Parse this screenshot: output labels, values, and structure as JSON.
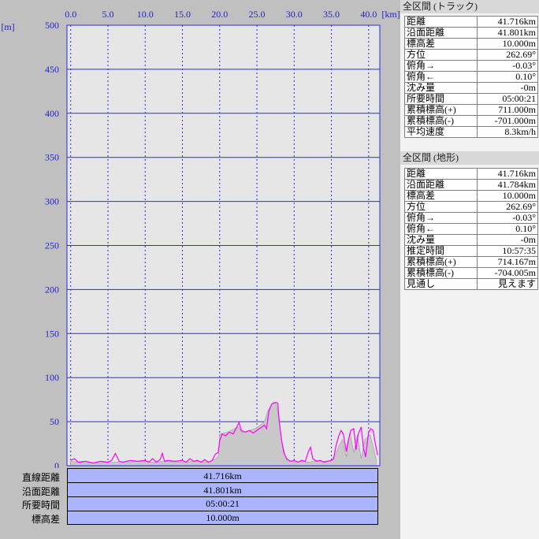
{
  "chart_data": {
    "type": "area",
    "xlabel": "[km]",
    "ylabel": "[m]",
    "xlim": [
      -0.5,
      41.5
    ],
    "ylim": [
      0,
      500
    ],
    "x_ticks": [
      "0.0",
      "5.0",
      "10.0",
      "15.0",
      "20.0",
      "25.0",
      "30.0",
      "35.0",
      "40.0"
    ],
    "y_ticks": [
      "0",
      "50",
      "100",
      "150",
      "200",
      "250",
      "300",
      "350",
      "400",
      "450",
      "500"
    ],
    "grid": true,
    "series": [
      {
        "name": "",
        "role": "terrain",
        "points": [
          [
            0,
            5
          ],
          [
            1,
            4
          ],
          [
            3,
            3
          ],
          [
            5,
            4
          ],
          [
            7,
            4
          ],
          [
            9,
            5
          ],
          [
            11,
            4
          ],
          [
            13,
            5
          ],
          [
            15,
            4
          ],
          [
            17,
            5
          ],
          [
            18.5,
            4
          ],
          [
            19.5,
            8
          ],
          [
            19.8,
            10
          ],
          [
            20,
            36
          ],
          [
            21,
            38
          ],
          [
            22,
            42
          ],
          [
            22.5,
            44
          ],
          [
            23,
            38
          ],
          [
            24,
            40
          ],
          [
            25,
            43
          ],
          [
            26,
            50
          ],
          [
            26.5,
            63
          ],
          [
            27.2,
            72
          ],
          [
            27.6,
            70
          ],
          [
            28,
            50
          ],
          [
            28.4,
            25
          ],
          [
            29,
            6
          ],
          [
            30,
            4
          ],
          [
            31,
            5
          ],
          [
            32,
            4
          ],
          [
            33,
            6
          ],
          [
            34,
            5
          ],
          [
            35,
            6
          ],
          [
            35.5,
            12
          ],
          [
            36,
            22
          ],
          [
            36.5,
            30
          ],
          [
            37,
            10
          ],
          [
            37.5,
            38
          ],
          [
            38,
            15
          ],
          [
            38.5,
            35
          ],
          [
            39,
            8
          ],
          [
            39.5,
            30
          ],
          [
            40.2,
            35
          ],
          [
            40.8,
            15
          ],
          [
            41,
            8
          ]
        ]
      },
      {
        "name": "",
        "role": "track",
        "points": [
          [
            0,
            6
          ],
          [
            0.5,
            8
          ],
          [
            1,
            4
          ],
          [
            2,
            5
          ],
          [
            3,
            3
          ],
          [
            4,
            5
          ],
          [
            5,
            4
          ],
          [
            5.5,
            6
          ],
          [
            6,
            14
          ],
          [
            6.5,
            5
          ],
          [
            7,
            4
          ],
          [
            8,
            6
          ],
          [
            9,
            5
          ],
          [
            10,
            6
          ],
          [
            10.5,
            4
          ],
          [
            11,
            8
          ],
          [
            11.5,
            4
          ],
          [
            12,
            7
          ],
          [
            12.3,
            14
          ],
          [
            12.6,
            5
          ],
          [
            13,
            6
          ],
          [
            14,
            5
          ],
          [
            15,
            6
          ],
          [
            15.5,
            4
          ],
          [
            16,
            8
          ],
          [
            16.5,
            5
          ],
          [
            17,
            6
          ],
          [
            17.5,
            4
          ],
          [
            18,
            7
          ],
          [
            18.5,
            4
          ],
          [
            19,
            6
          ],
          [
            19.4,
            13
          ],
          [
            19.8,
            15
          ],
          [
            20,
            28
          ],
          [
            20.3,
            36
          ],
          [
            20.8,
            34
          ],
          [
            21.3,
            38
          ],
          [
            21.8,
            36
          ],
          [
            22.3,
            44
          ],
          [
            22.6,
            49
          ],
          [
            22.9,
            40
          ],
          [
            23.4,
            38
          ],
          [
            24,
            40
          ],
          [
            24.5,
            37
          ],
          [
            25,
            40
          ],
          [
            25.5,
            43
          ],
          [
            26,
            46
          ],
          [
            26.3,
            42
          ],
          [
            26.6,
            62
          ],
          [
            27,
            70
          ],
          [
            27.5,
            72
          ],
          [
            27.8,
            71
          ],
          [
            28,
            50
          ],
          [
            28.3,
            30
          ],
          [
            28.6,
            15
          ],
          [
            29,
            8
          ],
          [
            29.5,
            5
          ],
          [
            30,
            6
          ],
          [
            30.5,
            4
          ],
          [
            31,
            6
          ],
          [
            31.5,
            5
          ],
          [
            31.9,
            16
          ],
          [
            32.2,
            21
          ],
          [
            32.5,
            8
          ],
          [
            33,
            5
          ],
          [
            33.5,
            6
          ],
          [
            34,
            4
          ],
          [
            34.5,
            5
          ],
          [
            35,
            6
          ],
          [
            35.3,
            8
          ],
          [
            35.6,
            22
          ],
          [
            36,
            34
          ],
          [
            36.3,
            40
          ],
          [
            36.6,
            36
          ],
          [
            37,
            16
          ],
          [
            37.3,
            30
          ],
          [
            37.6,
            40
          ],
          [
            38,
            42
          ],
          [
            38.3,
            18
          ],
          [
            38.6,
            36
          ],
          [
            39,
            44
          ],
          [
            39.3,
            20
          ],
          [
            39.6,
            10
          ],
          [
            40,
            38
          ],
          [
            40.3,
            42
          ],
          [
            40.6,
            40
          ],
          [
            40.9,
            25
          ],
          [
            41.2,
            12
          ]
        ]
      }
    ],
    "colors": {
      "plot_bg": "#e6e6e6",
      "grid": "#2a2aee",
      "axis_text": "#2222cc",
      "terrain": "#c8c8c8",
      "track": "#ff00ff"
    }
  },
  "summary": {
    "labels": [
      "直線距離",
      "沿面距離",
      "所要時間",
      "標高差"
    ],
    "values": [
      "41.716km",
      "41.801km",
      "05:00:21",
      "10.000m"
    ]
  },
  "track_panel": {
    "title": "全区間 (トラック)",
    "rows": [
      {
        "label": "距離",
        "value": "41.716km"
      },
      {
        "label": "沿面距離",
        "value": "41.801km"
      },
      {
        "label": "標高差",
        "value": "10.000m"
      },
      {
        "label": "方位",
        "value": "262.69°"
      },
      {
        "label": "俯角→",
        "value": "-0.03°"
      },
      {
        "label": "俯角←",
        "value": "0.10°"
      },
      {
        "label": "沈み量",
        "value": "-0m"
      },
      {
        "label": "所要時間",
        "value": "05:00:21"
      },
      {
        "label": "累積標高(+)",
        "value": "711.000m"
      },
      {
        "label": "累積標高(-)",
        "value": "-701.000m"
      },
      {
        "label": "平均速度",
        "value": "8.3km/h"
      }
    ]
  },
  "terrain_panel": {
    "title": "全区間 (地形)",
    "rows": [
      {
        "label": "距離",
        "value": "41.716km"
      },
      {
        "label": "沿面距離",
        "value": "41.784km"
      },
      {
        "label": "標高差",
        "value": "10.000m"
      },
      {
        "label": "方位",
        "value": "262.69°"
      },
      {
        "label": "俯角→",
        "value": "-0.03°"
      },
      {
        "label": "俯角←",
        "value": "0.10°"
      },
      {
        "label": "沈み量",
        "value": "-0m"
      },
      {
        "label": "推定時間",
        "value": "10:57:35"
      },
      {
        "label": "累積標高(+)",
        "value": "714.167m"
      },
      {
        "label": "累積標高(-)",
        "value": "-704.005m"
      },
      {
        "label": "見通し",
        "value": "見えます"
      }
    ]
  }
}
